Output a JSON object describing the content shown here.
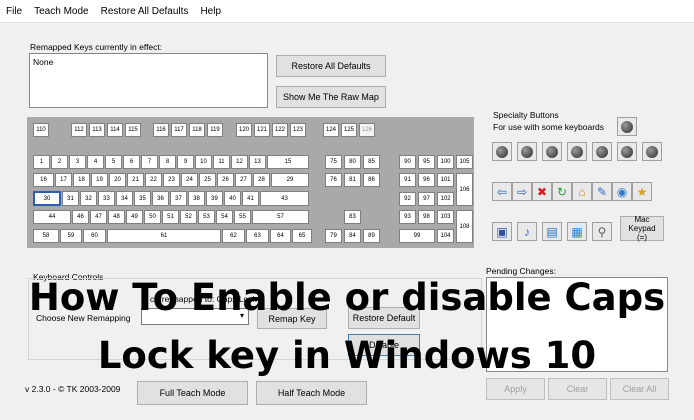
{
  "menu": [
    "File",
    "Teach Mode",
    "Restore All Defaults",
    "Help"
  ],
  "remapped": {
    "label": "Remapped Keys currently in effect:",
    "value": "None"
  },
  "buttons": {
    "restore_all": "Restore All Defaults",
    "raw_map": "Show Me The Raw Map",
    "remap_key": "Remap Key",
    "restore_default": "Restore Default",
    "disable": "Disable",
    "full_teach": "Full Teach Mode",
    "half_teach": "Half Teach Mode",
    "apply": "Apply",
    "clear": "Clear",
    "clear_all": "Clear All",
    "mac_keypad": "Mac Keypad (=)"
  },
  "specialty": {
    "title": "Specialty Buttons",
    "subtitle": "For use with some keyboards"
  },
  "controls": {
    "label": "Keyboard Controls",
    "mapped_text": "curre   mapped to: Caps Lock",
    "choose_label": "Choose New Remapping"
  },
  "pending": {
    "label": "Pending Changes:"
  },
  "version": "v 2.3.0 - © TK 2003-2009",
  "overlay": {
    "line1": "How To Enable or disable Caps",
    "line2": "Lock key in Windows 10"
  },
  "keyboard": {
    "fn_row": [
      "110",
      "112",
      "113",
      "114",
      "115",
      "116",
      "117",
      "118",
      "119",
      "120",
      "121",
      "122",
      "123",
      "124",
      "125",
      "126"
    ],
    "num_row": [
      "1",
      "2",
      "3",
      "4",
      "5",
      "6",
      "7",
      "8",
      "9",
      "10",
      "11",
      "12",
      "13",
      "15"
    ],
    "tab_row": [
      "16",
      "17",
      "18",
      "19",
      "20",
      "21",
      "22",
      "23",
      "24",
      "25",
      "26",
      "27",
      "28",
      "29"
    ],
    "caps_row": [
      "30",
      "31",
      "32",
      "33",
      "34",
      "35",
      "36",
      "37",
      "38",
      "39",
      "40",
      "41",
      "43"
    ],
    "shift_row": [
      "44",
      "46",
      "47",
      "48",
      "49",
      "50",
      "51",
      "52",
      "53",
      "54",
      "55",
      "57"
    ],
    "ctrl_row": [
      "58",
      "59",
      "60",
      "61",
      "62",
      "63",
      "64",
      "65"
    ],
    "nav_top": [
      "75",
      "80",
      "85"
    ],
    "nav_mid": [
      "76",
      "81",
      "86"
    ],
    "arrows": [
      "83",
      "79",
      "84",
      "89"
    ],
    "numpad_r1": [
      "90",
      "95",
      "100",
      "105"
    ],
    "numpad_r2": [
      "91",
      "96",
      "101"
    ],
    "numpad_r3": [
      "92",
      "97",
      "102"
    ],
    "numpad_r4": [
      "93",
      "98",
      "103"
    ],
    "numpad_r5": [
      "99",
      "104"
    ],
    "numpad_tall": [
      "106",
      "108"
    ]
  },
  "icons": [
    "left-arrow-icon",
    "right-arrow-icon",
    "stop-icon",
    "refresh-icon",
    "home-icon",
    "search-doc-icon",
    "globe-icon",
    "favorites-icon",
    "media-icon",
    "sound-icon",
    "computer-icon",
    "calculator-icon",
    "magnifier-icon"
  ]
}
